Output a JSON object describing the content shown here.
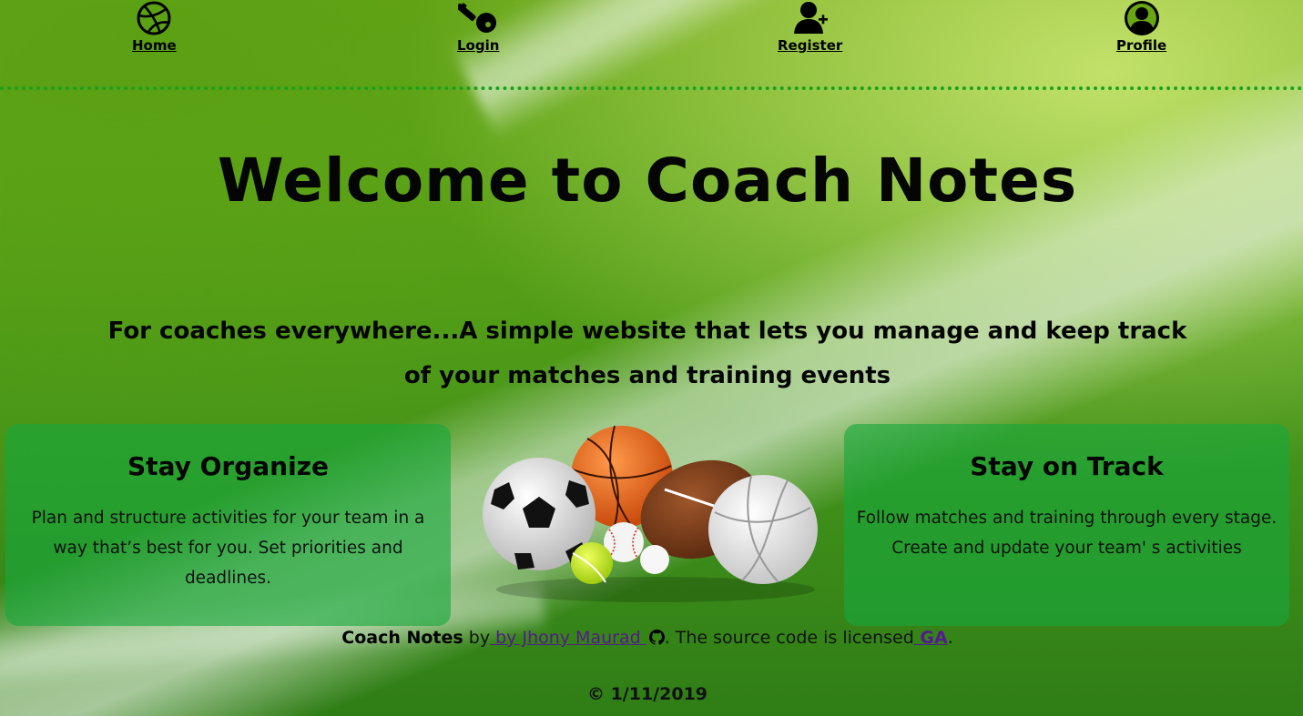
{
  "nav": {
    "items": [
      {
        "label": "Home",
        "icon": "dribbble-ball-icon"
      },
      {
        "label": "Login",
        "icon": "key-icon"
      },
      {
        "label": "Register",
        "icon": "add-user-icon"
      },
      {
        "label": "Profile",
        "icon": "user-circle-icon"
      }
    ]
  },
  "hero": {
    "title": "Welcome to Coach Notes",
    "subtitle": "For coaches everywhere...A simple website that lets you manage and keep track of your matches and training events"
  },
  "cards": [
    {
      "title": "Stay Organize",
      "text": "Plan and structure activities for your team in a way that’s best for you. Set priorities and deadlines."
    },
    {
      "title": "Stay on Track",
      "text": "Follow matches and training through every stage. Create and update your team' s activities"
    }
  ],
  "footer": {
    "brand": "Coach Notes",
    "by_text": " by",
    "author_link": " by Jhony Maurad ",
    "license_text": ". The source code is licensed",
    "license_link": " GA",
    "end_period": ".",
    "copyright": "© 1/11/2019"
  },
  "colors": {
    "nav_border": "#17a21c",
    "card_bg": "rgba(22,168,60,0.62)",
    "link": "#551a8b"
  }
}
